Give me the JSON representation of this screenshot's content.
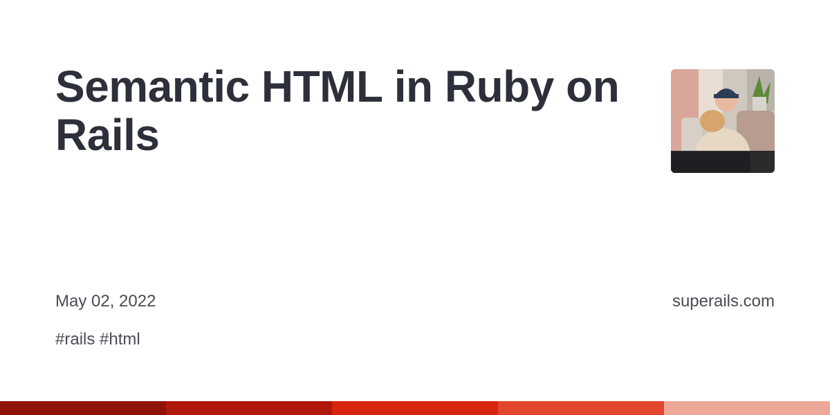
{
  "card": {
    "title": "Semantic HTML in Ruby on Rails",
    "date": "May 02, 2022",
    "site": "superails.com",
    "tags": "#rails #html"
  },
  "avatar": {
    "icon": "author-photo"
  },
  "colors": {
    "title": "#2d2f3a",
    "text": "#4a4b55",
    "stripe": [
      "#8e1309",
      "#b0180b",
      "#d8260e",
      "#e2462d",
      "#eda898"
    ]
  }
}
